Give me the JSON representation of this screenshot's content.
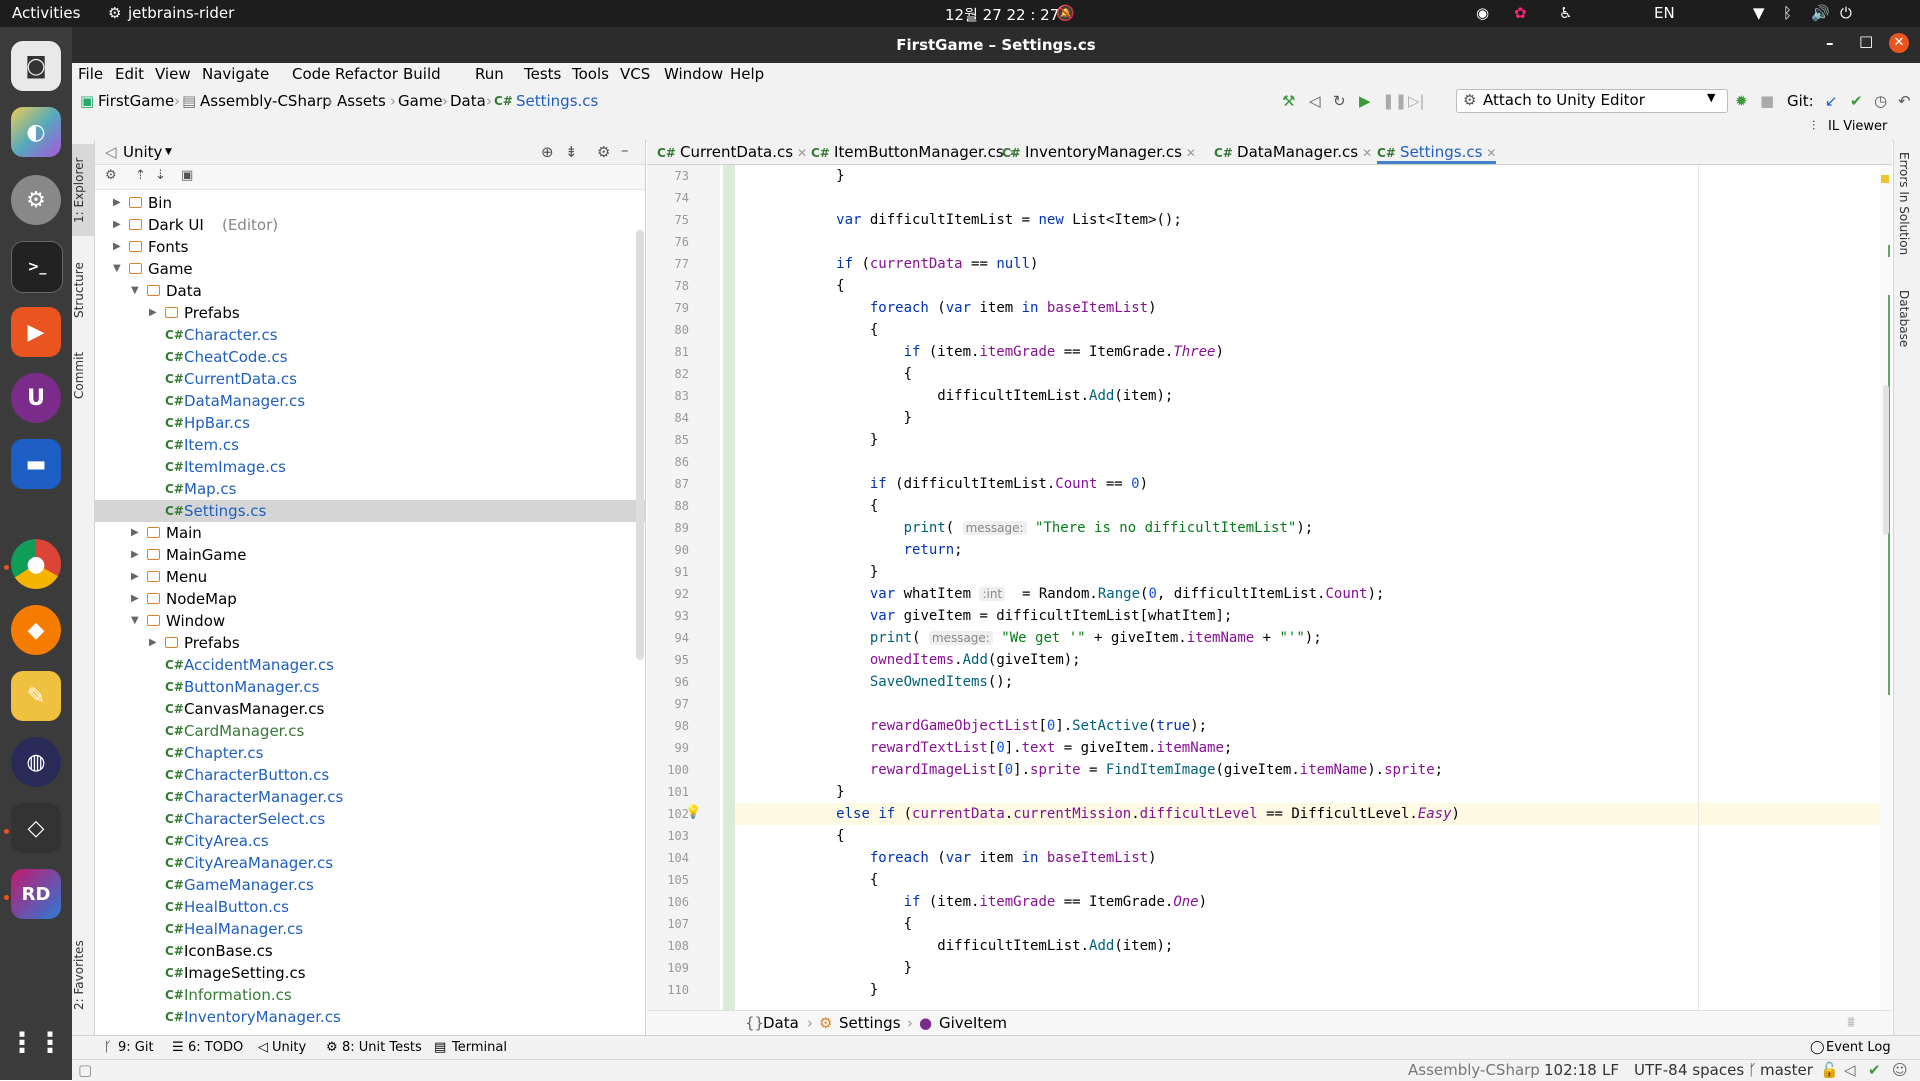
{
  "topbar": {
    "activities": "Activities",
    "app": "jetbrains-rider",
    "clock": "12월 27  22 : 27",
    "lang": "EN"
  },
  "window": {
    "title": "FirstGame – Settings.cs"
  },
  "menu": [
    "File",
    "Edit",
    "View",
    "Navigate",
    "Code",
    "Refactor",
    "Build",
    "Run",
    "Tests",
    "Tools",
    "VCS",
    "Window",
    "Help"
  ],
  "nav": {
    "crumbs": [
      "FirstGame",
      "Assembly-CSharp",
      "Assets",
      "Game",
      "Data",
      "Settings.cs"
    ],
    "run_config": "Attach to Unity Editor",
    "git_label": "Git:",
    "il_viewer": "IL Viewer"
  },
  "left_tabs": {
    "explorer": "1: Explorer",
    "structure": "Structure",
    "commit": "Commit",
    "favorites": "2: Favorites"
  },
  "right_tabs": {
    "errors": "Errors In Solution",
    "database": "Database"
  },
  "explorer": {
    "view": "Unity",
    "items": [
      {
        "label": "Bin",
        "type": "folder",
        "level": 0,
        "expanded": false
      },
      {
        "label": "Dark UI",
        "suffix": "(Editor)",
        "type": "folder",
        "level": 0,
        "expanded": false
      },
      {
        "label": "Fonts",
        "type": "folder",
        "level": 0,
        "expanded": false
      },
      {
        "label": "Game",
        "type": "folder",
        "level": 0,
        "expanded": true
      },
      {
        "label": "Data",
        "type": "folder",
        "level": 1,
        "expanded": true
      },
      {
        "label": "Prefabs",
        "type": "folder",
        "level": 2,
        "expanded": false
      },
      {
        "label": "Character.cs",
        "type": "cs",
        "level": 2
      },
      {
        "label": "CheatCode.cs",
        "type": "cs",
        "level": 2
      },
      {
        "label": "CurrentData.cs",
        "type": "cs",
        "level": 2
      },
      {
        "label": "DataManager.cs",
        "type": "cs",
        "level": 2
      },
      {
        "label": "HpBar.cs",
        "type": "cs",
        "level": 2
      },
      {
        "label": "Item.cs",
        "type": "cs",
        "level": 2
      },
      {
        "label": "ItemImage.cs",
        "type": "cs",
        "level": 2
      },
      {
        "label": "Map.cs",
        "type": "cs",
        "level": 2
      },
      {
        "label": "Settings.cs",
        "type": "cs",
        "level": 2,
        "selected": true
      },
      {
        "label": "Main",
        "type": "folder",
        "level": 1,
        "expanded": false
      },
      {
        "label": "MainGame",
        "type": "folder",
        "level": 1,
        "expanded": false
      },
      {
        "label": "Menu",
        "type": "folder",
        "level": 1,
        "expanded": false
      },
      {
        "label": "NodeMap",
        "type": "folder",
        "level": 1,
        "expanded": false
      },
      {
        "label": "Window",
        "type": "folder",
        "level": 1,
        "expanded": true
      },
      {
        "label": "Prefabs",
        "type": "folder",
        "level": 2,
        "expanded": false
      },
      {
        "label": "AccidentManager.cs",
        "type": "cs",
        "level": 2
      },
      {
        "label": "ButtonManager.cs",
        "type": "cs",
        "level": 2
      },
      {
        "label": "CanvasManager.cs",
        "type": "cs",
        "level": 2,
        "plain": true
      },
      {
        "label": "CardManager.cs",
        "type": "cs",
        "level": 2,
        "green": true
      },
      {
        "label": "Chapter.cs",
        "type": "cs",
        "level": 2
      },
      {
        "label": "CharacterButton.cs",
        "type": "cs",
        "level": 2
      },
      {
        "label": "CharacterManager.cs",
        "type": "cs",
        "level": 2
      },
      {
        "label": "CharacterSelect.cs",
        "type": "cs",
        "level": 2
      },
      {
        "label": "CityArea.cs",
        "type": "cs",
        "level": 2
      },
      {
        "label": "CityAreaManager.cs",
        "type": "cs",
        "level": 2
      },
      {
        "label": "GameManager.cs",
        "type": "cs",
        "level": 2
      },
      {
        "label": "HealButton.cs",
        "type": "cs",
        "level": 2
      },
      {
        "label": "HealManager.cs",
        "type": "cs",
        "level": 2
      },
      {
        "label": "IconBase.cs",
        "type": "cs",
        "level": 2,
        "plain": true
      },
      {
        "label": "ImageSetting.cs",
        "type": "cs",
        "level": 2,
        "plain": true
      },
      {
        "label": "Information.cs",
        "type": "cs",
        "level": 2,
        "green": true
      },
      {
        "label": "InventoryManager.cs",
        "type": "cs",
        "level": 2
      }
    ]
  },
  "tabs": [
    {
      "label": "CurrentData.cs",
      "active": false
    },
    {
      "label": "ItemButtonManager.cs",
      "active": false
    },
    {
      "label": "InventoryManager.cs",
      "active": false
    },
    {
      "label": "DataManager.cs",
      "active": false
    },
    {
      "label": "Settings.cs",
      "active": true
    }
  ],
  "code": {
    "lines": [
      {
        "n": 73,
        "html": "            }"
      },
      {
        "n": 74,
        "html": ""
      },
      {
        "n": 75,
        "html": "            <span class='kw'>var</span> difficultItemList = <span class='kw'>new</span> List&lt;Item&gt;();"
      },
      {
        "n": 76,
        "html": ""
      },
      {
        "n": 77,
        "html": "            <span class='kw'>if</span> (<span class='fld'>currentData</span> == <span class='kw'>null</span>)"
      },
      {
        "n": 78,
        "html": "            {"
      },
      {
        "n": 79,
        "html": "                <span class='kw'>foreach</span> (<span class='kw'>var</span> item <span class='kw'>in</span> <span class='fld'>baseItemList</span>)"
      },
      {
        "n": 80,
        "html": "                {"
      },
      {
        "n": 81,
        "html": "                    <span class='kw'>if</span> (item.<span class='fld'>itemGrade</span> == ItemGrade.<span class='ital'>Three</span>)"
      },
      {
        "n": 82,
        "html": "                    {"
      },
      {
        "n": 83,
        "html": "                        difficultItemList.<span class='mth'>Add</span>(item);"
      },
      {
        "n": 84,
        "html": "                    }"
      },
      {
        "n": 85,
        "html": "                }"
      },
      {
        "n": 86,
        "html": ""
      },
      {
        "n": 87,
        "html": "                <span class='kw'>if</span> (difficultItemList.<span class='fld'>Count</span> == <span class='num'>0</span>)"
      },
      {
        "n": 88,
        "html": "                {"
      },
      {
        "n": 89,
        "html": "                    <span class='mth'>print</span>( <span class='hint'>message:</span> <span class='str'>\"There is no difficultItemList\"</span>);"
      },
      {
        "n": 90,
        "html": "                    <span class='kw'>return</span>;"
      },
      {
        "n": 91,
        "html": "                }"
      },
      {
        "n": 92,
        "html": "                <span class='kw'>var</span> whatItem <span class='hint'>:int</span>  = Random.<span class='mth'>Range</span>(<span class='num'>0</span>, difficultItemList.<span class='fld'>Count</span>);"
      },
      {
        "n": 93,
        "html": "                <span class='kw'>var</span> giveItem = difficultItemList[whatItem];"
      },
      {
        "n": 94,
        "html": "                <span class='mth'>print</span>( <span class='hint'>message:</span> <span class='str'>\"We get '\"</span> + giveItem.<span class='fld'>itemName</span> + <span class='str'>\"'\"</span>);"
      },
      {
        "n": 95,
        "html": "                <span class='fld'>ownedItems</span>.<span class='mth'>Add</span>(giveItem);"
      },
      {
        "n": 96,
        "html": "                <span class='mth'>SaveOwnedItems</span>();"
      },
      {
        "n": 97,
        "html": ""
      },
      {
        "n": 98,
        "html": "                <span class='fld'>rewardGameObjectList</span>[<span class='num'>0</span>].<span class='mth'>SetActive</span>(<span class='kw'>true</span>);"
      },
      {
        "n": 99,
        "html": "                <span class='fld'>rewardTextList</span>[<span class='num'>0</span>].<span class='fld'>text</span> = giveItem.<span class='fld'>itemName</span>;"
      },
      {
        "n": 100,
        "html": "                <span class='fld'>rewardImageList</span>[<span class='num'>0</span>].<span class='fld'>sprite</span> = <span class='mth'>FindItemImage</span>(giveItem.<span class='fld'>itemName</span>).<span class='fld'>sprite</span>;"
      },
      {
        "n": 101,
        "html": "            }"
      },
      {
        "n": 102,
        "html": "            <span class='kw'>else</span> <span class='kw'>if</span> (<span class='fld'>currentData</span>.<span class='fld'>currentMission</span>.<span class='fld'>difficultLevel</span> == DifficultLevel.<span class='ital'>Easy</span>)",
        "current": true
      },
      {
        "n": 103,
        "html": "            {"
      },
      {
        "n": 104,
        "html": "                <span class='kw'>foreach</span> (<span class='kw'>var</span> item <span class='kw'>in</span> <span class='fld'>baseItemList</span>)"
      },
      {
        "n": 105,
        "html": "                {"
      },
      {
        "n": 106,
        "html": "                    <span class='kw'>if</span> (item.<span class='fld'>itemGrade</span> == ItemGrade.<span class='ital'>One</span>)"
      },
      {
        "n": 107,
        "html": "                    {"
      },
      {
        "n": 108,
        "html": "                        difficultItemList.<span class='mth'>Add</span>(item);"
      },
      {
        "n": 109,
        "html": "                    }"
      },
      {
        "n": 110,
        "html": "                }"
      }
    ]
  },
  "editor_breadcrumb": [
    "Data",
    "Settings",
    "GiveItem"
  ],
  "tool_windows": [
    "9: Git",
    "6: TODO",
    "Unity",
    "8: Unit Tests",
    "Terminal"
  ],
  "event_log": "Event Log",
  "status": {
    "project": "Assembly-CSharp",
    "position": "102:18",
    "line_sep": "LF",
    "encoding": "UTF-8",
    "indent": "4 spaces",
    "branch": "master"
  },
  "colors": {
    "accent": "#1f5fbf",
    "cs_green": "#367a34",
    "folder": "#d9822b"
  }
}
